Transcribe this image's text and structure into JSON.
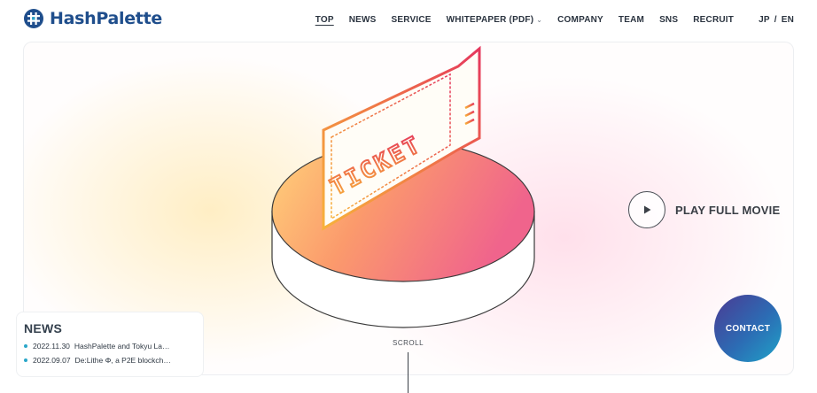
{
  "brand": {
    "name": "HashPalette",
    "accent": "#1f4e8c",
    "secondary": "#2ba7c9"
  },
  "nav": {
    "items": [
      {
        "label": "TOP",
        "active": true
      },
      {
        "label": "NEWS",
        "active": false
      },
      {
        "label": "SERVICE",
        "active": false
      },
      {
        "label": "WHITEPAPER (PDF)",
        "active": false,
        "has_dropdown": true
      },
      {
        "label": "COMPANY",
        "active": false
      },
      {
        "label": "TEAM",
        "active": false
      },
      {
        "label": "SNS",
        "active": false
      },
      {
        "label": "RECRUIT",
        "active": false
      }
    ],
    "lang": {
      "jp": "JP",
      "separator": "/",
      "en": "EN"
    }
  },
  "hero": {
    "illustration_text": "TICKET",
    "play_label": "PLAY FULL MOVIE",
    "play_icon": "play-icon",
    "scroll_label": "SCROLL",
    "contact_label": "CONTACT"
  },
  "news": {
    "title": "NEWS",
    "items": [
      {
        "date": "2022.11.30",
        "text": "HashPalette and Tokyu La…"
      },
      {
        "date": "2022.09.07",
        "text": "De:Lithe Φ, a P2E blockch…"
      }
    ]
  }
}
